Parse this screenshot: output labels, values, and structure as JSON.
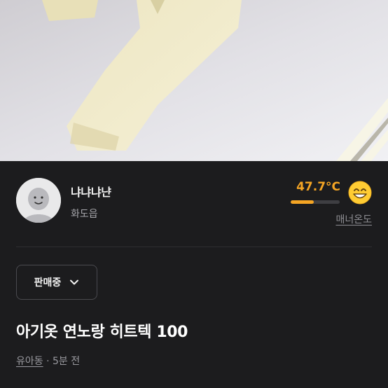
{
  "seller": {
    "name": "냐냐냐냔",
    "location": "화도읍",
    "temperature": "47.7°C",
    "temperature_fill_percent": 47.7,
    "manner_label": "매너온도"
  },
  "status": {
    "label": "판매중"
  },
  "product": {
    "title": "아기옷 연노랑 히트텍 100",
    "location": "유아동",
    "separator": "·",
    "time": "5분 전"
  },
  "colors": {
    "background": "#1c1c1e",
    "accent": "#f5a524"
  }
}
